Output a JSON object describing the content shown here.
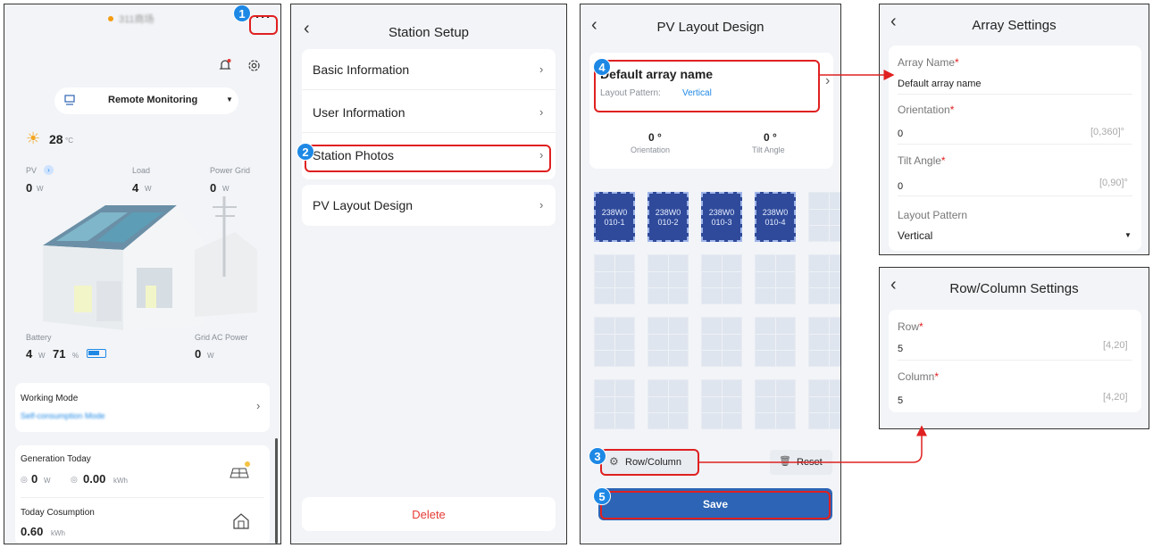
{
  "colors": {
    "accent": "#1e88e5",
    "highlight": "#e02020",
    "save": "#2d64b5",
    "panel": "#2f4a9a"
  },
  "screen1": {
    "station_name": "311商场",
    "menu_glyph": "···",
    "remote_label": "Remote Monitoring",
    "temperature": "28",
    "temp_unit": "°C",
    "pv": {
      "label": "PV",
      "value": "0",
      "unit": "W"
    },
    "load": {
      "label": "Load",
      "value": "4",
      "unit": "W"
    },
    "grid": {
      "label": "Power Grid",
      "value": "0",
      "unit": "W"
    },
    "battery": {
      "label": "Battery",
      "value": "4",
      "unit": "W",
      "soc": "71",
      "soc_unit": "%"
    },
    "grid_ac": {
      "label": "Grid AC Power",
      "value": "0",
      "unit": "W"
    },
    "working_mode": {
      "label": "Working Mode",
      "value": "Self-consumption Mode"
    },
    "generation": {
      "label": "Generation Today",
      "power": "0",
      "power_unit": "W",
      "energy": "0.00",
      "energy_unit": "kWh"
    },
    "consumption": {
      "label": "Today Cosumption",
      "value": "0.60",
      "unit": "kWh"
    }
  },
  "screen2": {
    "title": "Station Setup",
    "items": [
      "Basic Information",
      "User Information",
      "Station Photos",
      "PV Layout Design"
    ],
    "delete_label": "Delete"
  },
  "screen3": {
    "title": "PV Layout Design",
    "array_name": "Default array name",
    "pattern_label": "Layout Pattern:",
    "pattern_value": "Vertical",
    "orientation": {
      "value": "0 °",
      "label": "Orientation"
    },
    "tilt": {
      "value": "0 °",
      "label": "Tilt Angle"
    },
    "panels": [
      "238W0 010-1",
      "238W0 010-2",
      "238W0 010-3",
      "238W0 010-4"
    ],
    "row_column_label": "Row/Column",
    "reset_label": "Reset",
    "save_label": "Save"
  },
  "screen4": {
    "title": "Array Settings",
    "array_name_label": "Array Name",
    "array_name_value": "Default array name",
    "orientation_label": "Orientation",
    "orientation_value": "0",
    "orientation_range": "[0,360]°",
    "tilt_label": "Tilt Angle",
    "tilt_value": "0",
    "tilt_range": "[0,90]°",
    "pattern_label": "Layout Pattern",
    "pattern_value": "Vertical"
  },
  "screen5": {
    "title": "Row/Column Settings",
    "row_label": "Row",
    "row_value": "5",
    "row_range": "[4,20]",
    "column_label": "Column",
    "column_value": "5",
    "column_range": "[4,20]"
  },
  "badges": [
    "1",
    "2",
    "3",
    "4",
    "5"
  ],
  "required_mark": "*"
}
